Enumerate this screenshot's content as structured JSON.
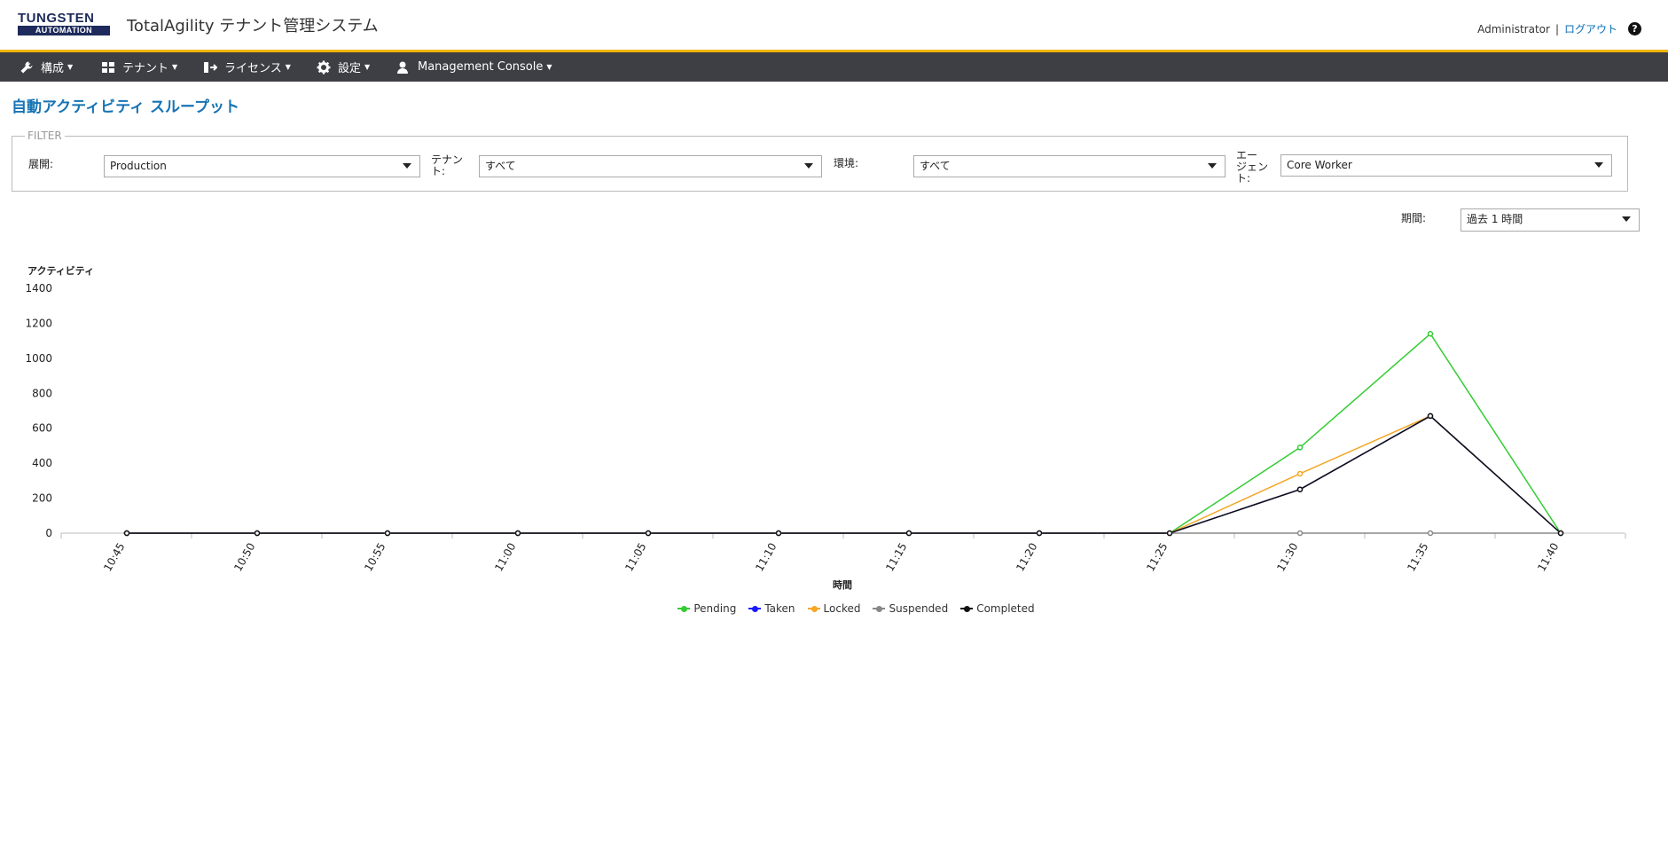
{
  "header": {
    "logo_line1": "TUNGSTEN",
    "logo_line2": "AUTOMATION",
    "app_title": "TotalAgility テナント管理システム",
    "user": "Administrator",
    "separator": "|",
    "logout": "ログアウト",
    "help": "?"
  },
  "nav": [
    {
      "label": "構成",
      "icon": "wrench-icon"
    },
    {
      "label": "テナント",
      "icon": "grid-icon"
    },
    {
      "label": "ライセンス",
      "icon": "license-icon"
    },
    {
      "label": "設定",
      "icon": "gear-icon"
    },
    {
      "label": "Management Console",
      "icon": "user-icon"
    }
  ],
  "page_title": "自動アクティビティ スループット",
  "filter": {
    "legend": "FILTER",
    "deployment_label": "展開:",
    "deployment_value": "Production",
    "tenant_label_1": "テナン",
    "tenant_label_2": "ト:",
    "tenant_value": "すべて",
    "environment_label": "環境:",
    "environment_value": "すべて",
    "agent_label_1": "エー",
    "agent_label_2": "ジェン",
    "agent_label_3": "ト:",
    "agent_value": "Core Worker"
  },
  "period": {
    "label": "期間:",
    "value": "過去 1 時間"
  },
  "chart_data": {
    "type": "line",
    "ylabel": "アクティビティ",
    "xlabel": "時間",
    "ylim": [
      0,
      1400
    ],
    "yticks": [
      0,
      200,
      400,
      600,
      800,
      1000,
      1200,
      1400
    ],
    "categories": [
      "10:45",
      "10:50",
      "10:55",
      "11:00",
      "11:05",
      "11:10",
      "11:15",
      "11:20",
      "11:25",
      "11:30",
      "11:35",
      "11:40"
    ],
    "series": [
      {
        "name": "Pending",
        "color": "#33cc33",
        "values": [
          0,
          0,
          0,
          0,
          0,
          0,
          0,
          0,
          0,
          490,
          1140,
          0
        ]
      },
      {
        "name": "Taken",
        "color": "#1a1aff",
        "values": [
          0,
          0,
          0,
          0,
          0,
          0,
          0,
          0,
          0,
          250,
          670,
          0
        ]
      },
      {
        "name": "Locked",
        "color": "#f5a623",
        "values": [
          0,
          0,
          0,
          0,
          0,
          0,
          0,
          0,
          0,
          340,
          670,
          0
        ]
      },
      {
        "name": "Suspended",
        "color": "#888888",
        "values": [
          0,
          0,
          0,
          0,
          0,
          0,
          0,
          0,
          0,
          0,
          0,
          0
        ]
      },
      {
        "name": "Completed",
        "color": "#111111",
        "values": [
          0,
          0,
          0,
          0,
          0,
          0,
          0,
          0,
          0,
          250,
          670,
          0
        ]
      }
    ],
    "legend_position": "bottom",
    "grid": false
  }
}
